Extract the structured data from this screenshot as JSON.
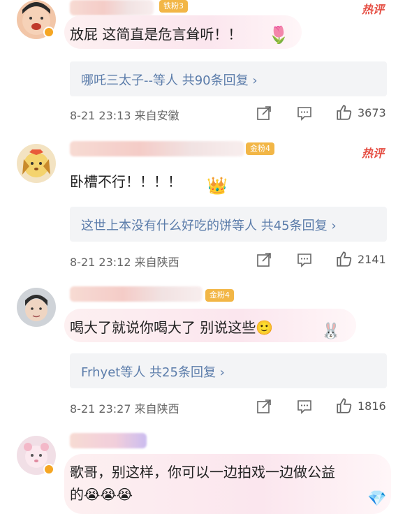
{
  "comments": [
    {
      "fan_badge": "铁粉3",
      "hot_label": "热评",
      "text": "放屁 这简直是危言耸听！！",
      "replies": "哪吒三太子--等人 共90条回复 ›",
      "meta": "8-21 23:13 来自安徽",
      "likes": "3673",
      "avatar_color": "#f2c6a8"
    },
    {
      "fan_badge": "金粉4",
      "hot_label": "热评",
      "text": "卧槽不行！！！！",
      "replies": "这世上本没有什么好吃的饼等人 共45条回复 ›",
      "meta": "8-21 23:12 来自陕西",
      "likes": "2141",
      "avatar_color": "#e9c66e"
    },
    {
      "fan_badge": "金粉4",
      "hot_label": "",
      "text": "喝大了就说你喝大了 别说这些🙂",
      "replies": "Frhyet等人 共25条回复 ›",
      "meta": "8-21 23:27 来自陕西",
      "likes": "1816",
      "avatar_color": "#cfd3d8"
    },
    {
      "fan_badge": "",
      "hot_label": "",
      "text_line1": "歌哥，别这样，你可以一边拍戏一边做公益",
      "text_line2": "的😭😭😭",
      "avatar_color": "#f1dfe6"
    }
  ],
  "icons": {
    "share": "share-icon",
    "comment": "comment-icon",
    "like": "thumbs-up-icon"
  },
  "colors": {
    "link": "#5b7caa",
    "hot": "#e54d42",
    "badge": "#f2b646"
  }
}
